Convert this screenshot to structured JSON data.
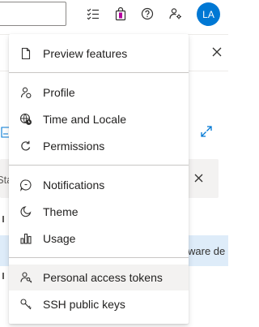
{
  "header": {
    "avatar_initials": "LA",
    "icons": [
      "task-list-icon",
      "shopping-bag-icon",
      "help-icon",
      "user-settings-icon"
    ]
  },
  "background": {
    "message_prefix": "Sta",
    "stripe_text": "ware de"
  },
  "menu": {
    "items": [
      {
        "label": "Preview features",
        "icon": "document-icon"
      },
      {
        "label": "Profile",
        "icon": "profile-icon"
      },
      {
        "label": "Time and Locale",
        "icon": "globe-clock-icon"
      },
      {
        "label": "Permissions",
        "icon": "refresh-icon"
      },
      {
        "label": "Notifications",
        "icon": "chat-icon"
      },
      {
        "label": "Theme",
        "icon": "theme-icon"
      },
      {
        "label": "Usage",
        "icon": "bar-chart-icon"
      },
      {
        "label": "Personal access tokens",
        "icon": "key-user-icon",
        "hovered": true
      },
      {
        "label": "SSH public keys",
        "icon": "ssh-key-icon"
      }
    ]
  },
  "colors": {
    "accent": "#0078d4",
    "hover": "#f3f2f1",
    "stripe": "#deecf9",
    "text": "#201f1e"
  }
}
